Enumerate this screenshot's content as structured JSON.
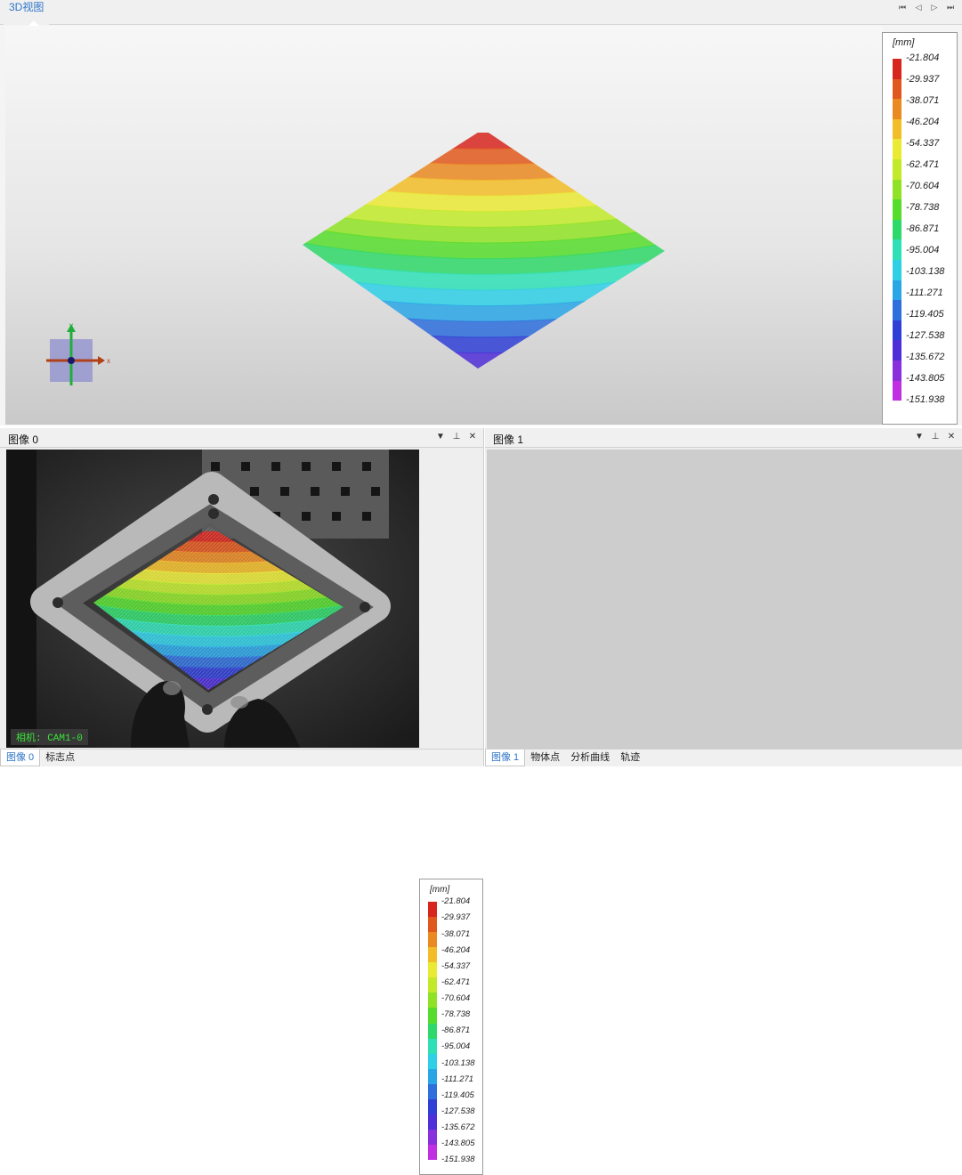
{
  "view3d": {
    "tab_title": "3D视图",
    "nav_icons": [
      "first-icon",
      "prev-icon",
      "next-icon",
      "last-icon"
    ]
  },
  "axes": {
    "x_label": "x",
    "y_label": "y"
  },
  "legend": {
    "unit": "[mm]",
    "ticks": [
      "-21.804",
      "-29.937",
      "-38.071",
      "-46.204",
      "-54.337",
      "-62.471",
      "-70.604",
      "-78.738",
      "-86.871",
      "-95.004",
      "-103.138",
      "-111.271",
      "-119.405",
      "-127.538",
      "-135.672",
      "-143.805",
      "-151.938"
    ],
    "colors": [
      "#d7261e",
      "#e0581d",
      "#ea8a22",
      "#f2bd28",
      "#eaea35",
      "#c2ea2a",
      "#8fe225",
      "#55dc2c",
      "#2fd86a",
      "#2fe0b7",
      "#2fcfe6",
      "#2aa6e6",
      "#2f6fdc",
      "#3040d6",
      "#4f2fd8",
      "#8a2fdc",
      "#c02fe0"
    ]
  },
  "panel0": {
    "title": "图像 0",
    "camera_label": "相机: CAM1-0",
    "tabs": [
      {
        "label": "图像 0",
        "active": true
      },
      {
        "label": "标志点",
        "active": false
      }
    ]
  },
  "panel1": {
    "title": "图像 1",
    "tabs": [
      {
        "label": "图像 1",
        "active": true
      },
      {
        "label": "物体点",
        "active": false
      },
      {
        "label": "分析曲线",
        "active": false
      },
      {
        "label": "轨迹",
        "active": false
      }
    ]
  },
  "panel_buttons": {
    "menu_icon": "dropdown-icon",
    "pin_icon": "pin-icon",
    "close_icon": "close-icon"
  }
}
